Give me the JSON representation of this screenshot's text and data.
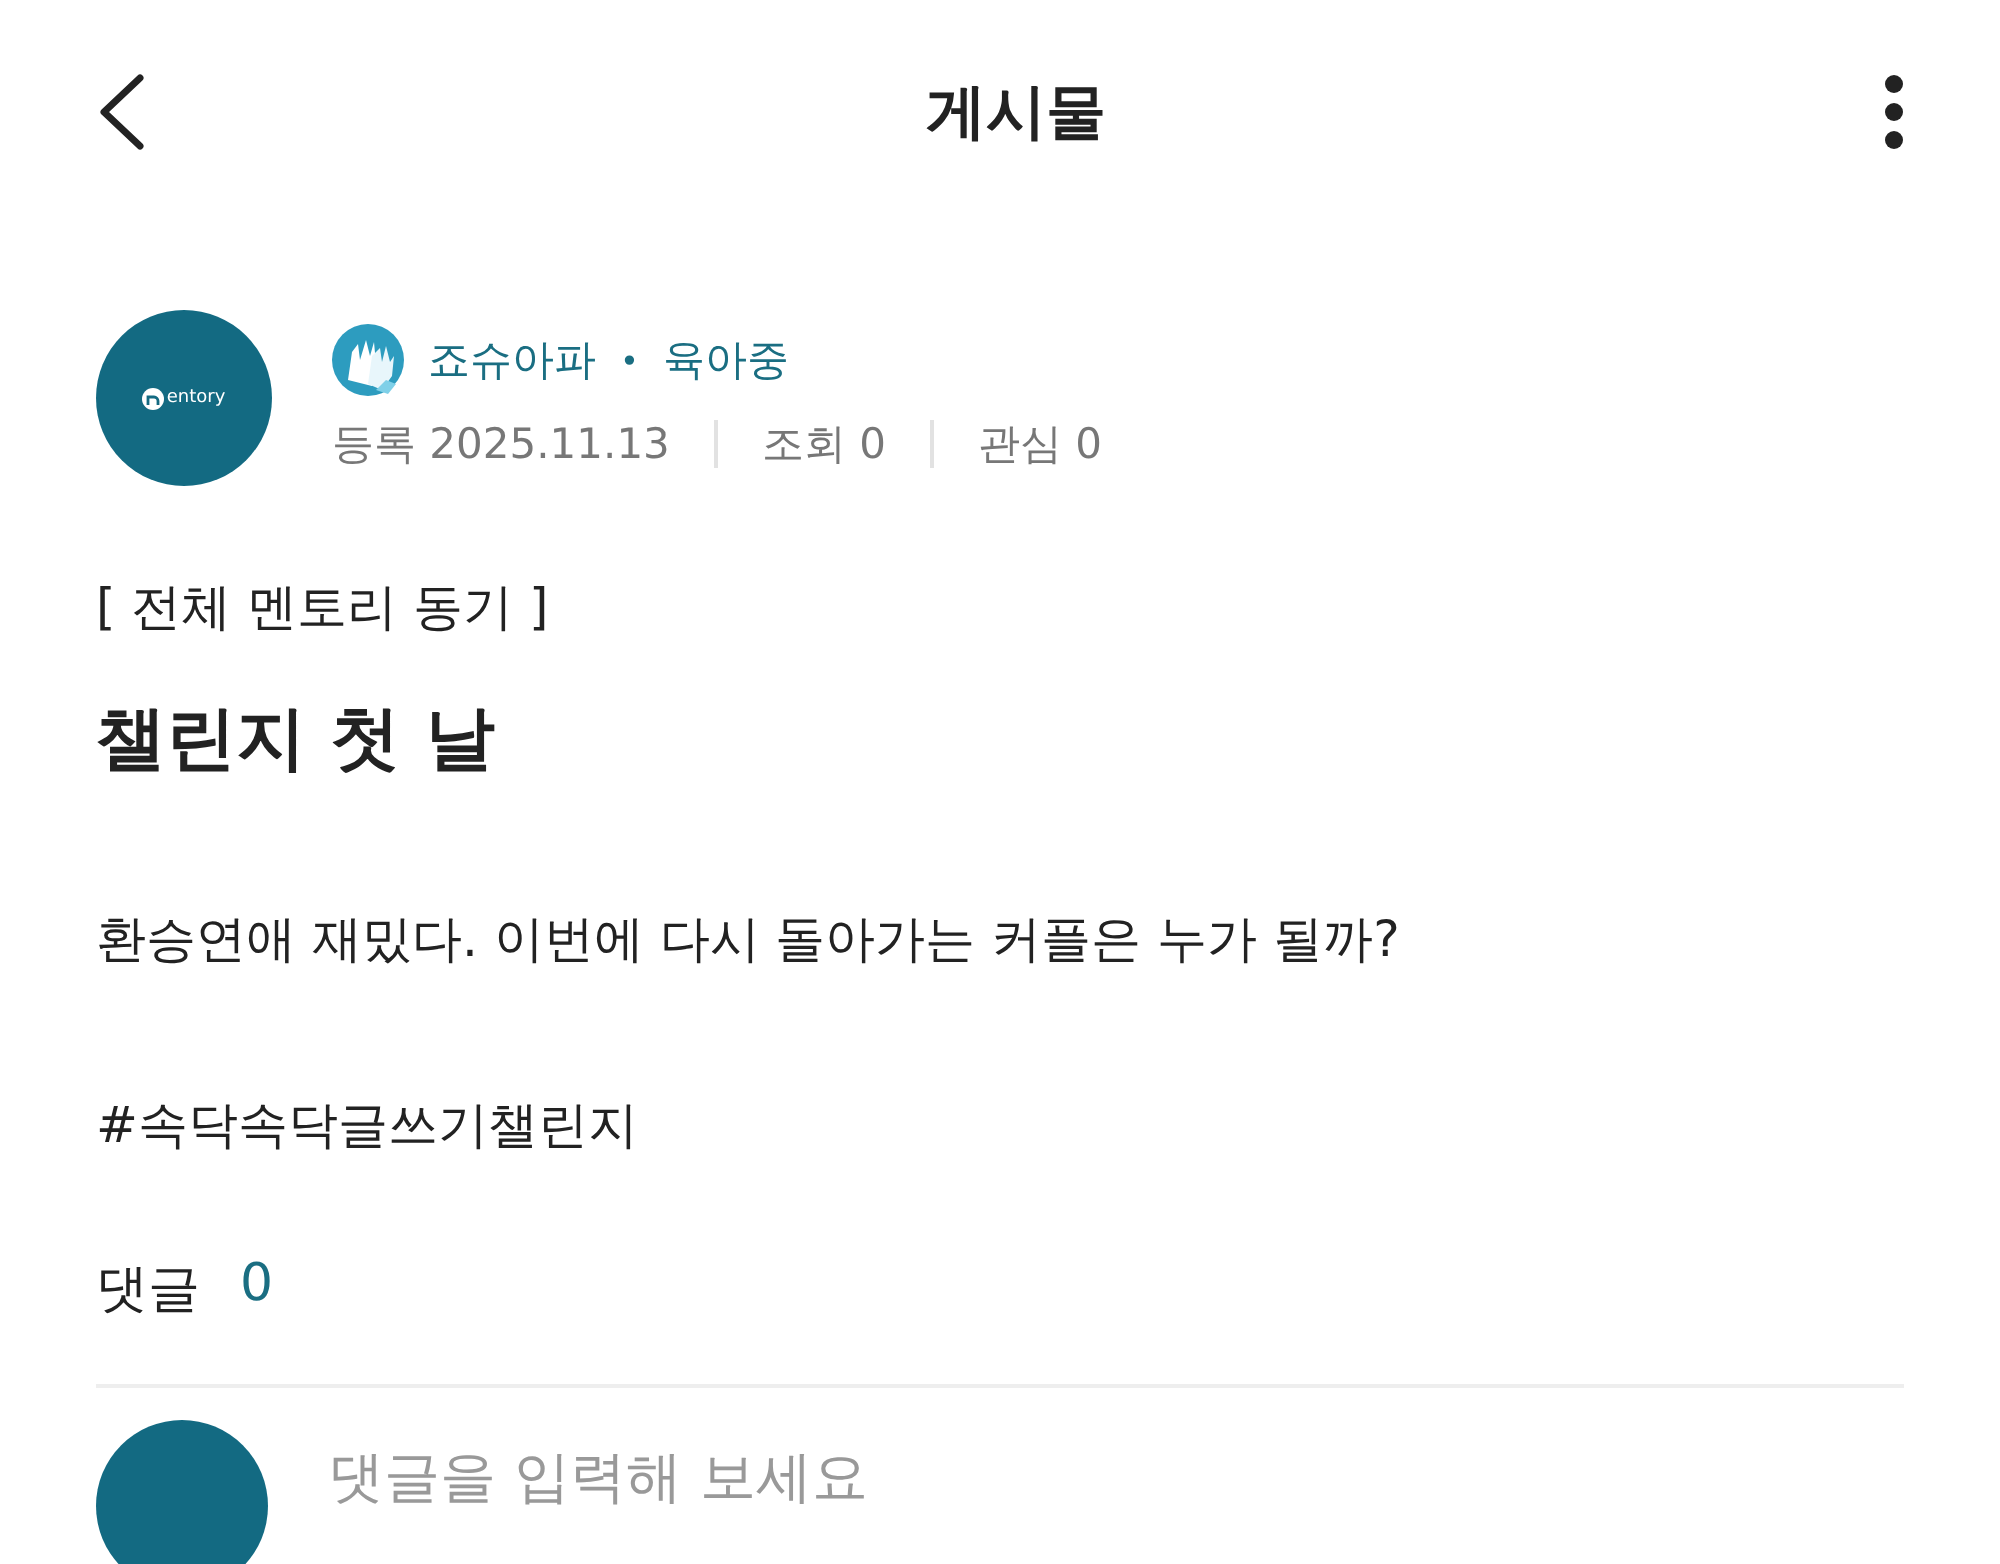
{
  "header": {
    "title": "게시물"
  },
  "author": {
    "logo_text": "entory",
    "name": "죠슈아파",
    "separator": "•",
    "status": "육아중",
    "meta": [
      {
        "label": "등록",
        "value": "2025.11.13"
      },
      {
        "label": "조회",
        "value": "0"
      },
      {
        "label": "관심",
        "value": "0"
      }
    ]
  },
  "post": {
    "category": "[ 전체 멘토리 동기 ]",
    "title": "챌린지 첫 날",
    "body": "환승연애 재밌다. 이번에 다시 돌아가는 커플은 누가 될까?",
    "hashtag": "#속닥속닥글쓰기챌린지"
  },
  "comments": {
    "label": "댓글",
    "count": "0",
    "input": {
      "placeholder": "댓글을 입력해 보세요"
    }
  }
}
